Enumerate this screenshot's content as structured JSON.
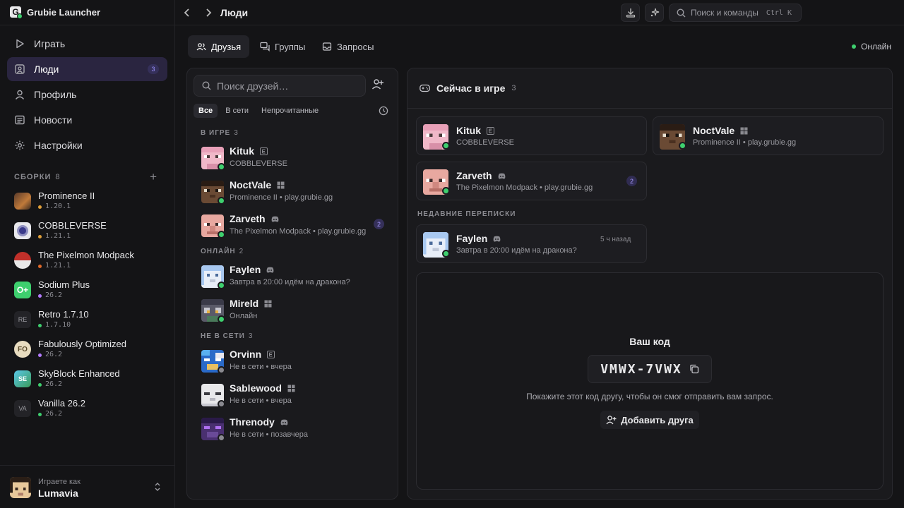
{
  "app": {
    "title": "Grubie Launcher"
  },
  "header": {
    "breadcrumb": "Люди",
    "search_placeholder": "Поиск и команды",
    "search_shortcut": "Ctrl K"
  },
  "sidebar": {
    "nav": [
      {
        "label": "Играть",
        "icon": "play-icon"
      },
      {
        "label": "Люди",
        "icon": "people-icon",
        "badge": "3",
        "active": true
      },
      {
        "label": "Профиль",
        "icon": "user-icon"
      },
      {
        "label": "Новости",
        "icon": "news-icon"
      },
      {
        "label": "Настройки",
        "icon": "gear-icon"
      }
    ],
    "packs_title": "СБОРКИ",
    "packs_count": "8",
    "packs": [
      {
        "name": "Prominence II",
        "version": "1.20.1",
        "dot": "#e0a03a"
      },
      {
        "name": "COBBLEVERSE",
        "version": "1.21.1",
        "dot": "#e0a03a"
      },
      {
        "name": "The Pixelmon Modpack",
        "version": "1.21.1",
        "dot": "#e06a2a"
      },
      {
        "name": "Sodium Plus",
        "version": "26.2",
        "dot": "#b47cff"
      },
      {
        "name": "Retro 1.7.10",
        "version": "1.7.10",
        "dot": "#3ecf6e",
        "icon_text": "RE"
      },
      {
        "name": "Fabulously Optimized",
        "version": "26.2",
        "dot": "#b47cff",
        "icon_text": "FO"
      },
      {
        "name": "SkyBlock Enhanced",
        "version": "26.2",
        "dot": "#3ecf6e"
      },
      {
        "name": "Vanilla 26.2",
        "version": "26.2",
        "dot": "#3ecf6e",
        "icon_text": "VA"
      }
    ],
    "user": {
      "label": "Играете как",
      "name": "Lumavia"
    }
  },
  "tabs": [
    "Друзья",
    "Группы",
    "Запросы"
  ],
  "status": "Онлайн",
  "friends": {
    "search_placeholder": "Поиск друзей…",
    "filters": [
      "Все",
      "В сети",
      "Непрочитанные"
    ],
    "sections": [
      {
        "title": "В ИГРЕ",
        "count": "3"
      },
      {
        "title": "ОНЛАЙН",
        "count": "2"
      },
      {
        "title": "НЕ В СЕТИ",
        "count": "3"
      }
    ],
    "list": [
      {
        "name": "Kituk",
        "sub": "COBBLEVERSE",
        "platform": "java-icon",
        "status": "online"
      },
      {
        "name": "NoctVale",
        "sub": "Prominence II • play.grubie.gg",
        "platform": "windows-icon",
        "status": "online"
      },
      {
        "name": "Zarveth",
        "sub": "The Pixelmon Modpack • play.grubie.gg",
        "platform": "discord-icon",
        "status": "online",
        "unread": "2"
      },
      {
        "name": "Faylen",
        "sub": "Завтра в 20:00 идём на дракона?",
        "platform": "discord-icon",
        "status": "online"
      },
      {
        "name": "Mireld",
        "sub": "Онлайн",
        "platform": "windows-icon",
        "status": "online"
      },
      {
        "name": "Orvinn",
        "sub": "Не в сети • вчера",
        "platform": "java-icon",
        "status": "offline"
      },
      {
        "name": "Sablewood",
        "sub": "Не в сети • вчера",
        "platform": "windows-icon",
        "status": "offline"
      },
      {
        "name": "Threnody",
        "sub": "Не в сети • позавчера",
        "platform": "discord-icon",
        "status": "offline"
      }
    ]
  },
  "now_playing": {
    "title": "Сейчас в игре",
    "count": "3",
    "cards": [
      {
        "name": "Kituk",
        "sub": "COBBLEVERSE"
      },
      {
        "name": "NoctVale",
        "sub": "Prominence II • play.grubie.gg"
      },
      {
        "name": "Zarveth",
        "sub": "The Pixelmon Modpack • play.grubie.gg",
        "unread": "2"
      }
    ],
    "recent_title": "НЕДАВНИЕ ПЕРЕПИСКИ",
    "recent": {
      "name": "Faylen",
      "sub": "Завтра в 20:00 идём на дракона?",
      "time": "5 ч назад"
    }
  },
  "code": {
    "title": "Ваш код",
    "value": "VMWX-7VWX",
    "hint": "Покажите этот код другу, чтобы он смог отправить вам запрос.",
    "add_button": "Добавить друга"
  },
  "colors": {
    "online": "#3ecf6e",
    "offline": "#8a8a90",
    "accent": "#9d92ff"
  }
}
